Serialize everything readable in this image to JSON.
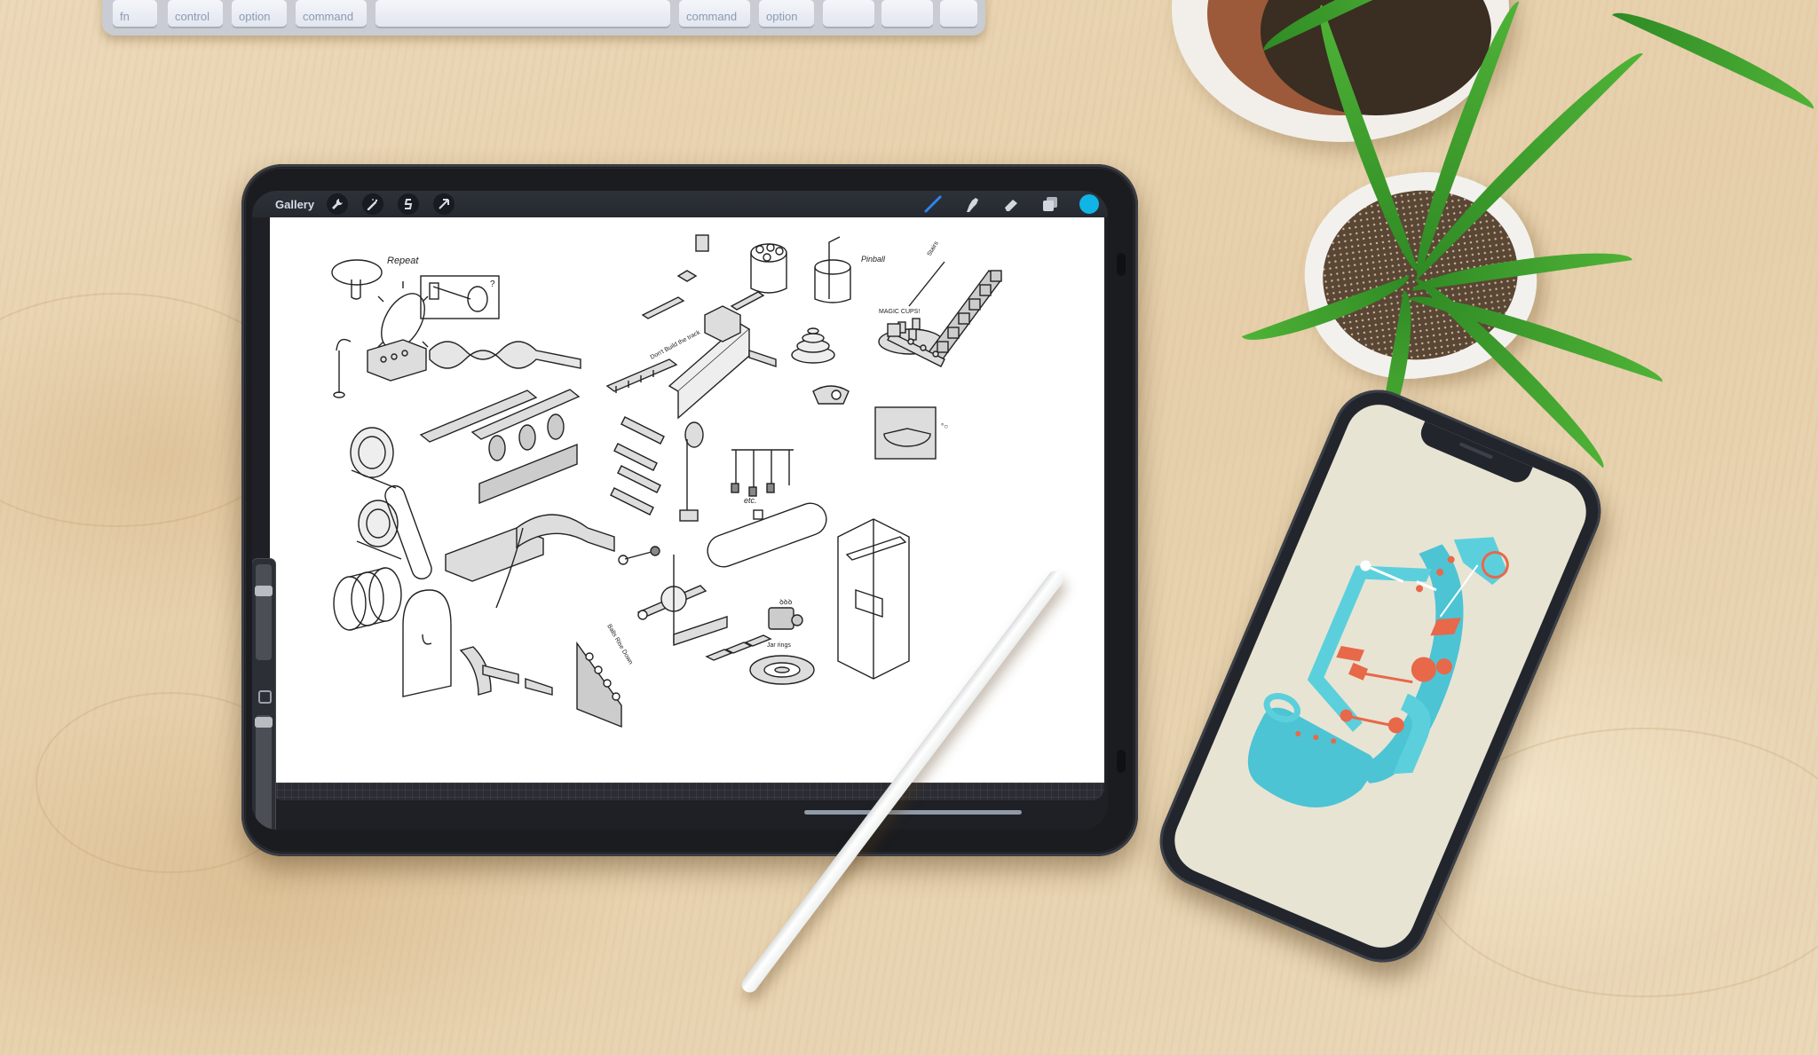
{
  "scene": {
    "desk_color": "#e9d5b4",
    "objects": [
      "keyboard",
      "tablet",
      "stylus-pencil",
      "smartphone",
      "potted-plants"
    ]
  },
  "keyboard": {
    "keys": [
      "fn",
      "control",
      "option",
      "command",
      "",
      "command",
      "option",
      "◀",
      "▼",
      "▶"
    ]
  },
  "app": {
    "toolbar": {
      "gallery_label": "Gallery",
      "left_tools": [
        {
          "name": "actions",
          "icon": "wrench-icon"
        },
        {
          "name": "adjustments",
          "icon": "magic-wand-icon"
        },
        {
          "name": "selection",
          "icon": "selection-s-icon"
        },
        {
          "name": "transform",
          "icon": "arrow-cursor-icon"
        }
      ],
      "right_tools": [
        {
          "name": "brush",
          "icon": "brush-icon",
          "active": true
        },
        {
          "name": "smudge",
          "icon": "smudge-finger-icon"
        },
        {
          "name": "eraser",
          "icon": "eraser-icon"
        },
        {
          "name": "layers",
          "icon": "layers-icon"
        },
        {
          "name": "color",
          "icon": "color-swatch",
          "value": "#10b4e6"
        }
      ]
    },
    "sidebar": {
      "brush_size": 0.12,
      "opacity": 0.02,
      "modify_button": "square",
      "undo_icon": "↶",
      "redo_icon": "↷"
    },
    "canvas": {
      "annotations": [
        "Repeat",
        "?",
        "Pinball",
        "MAGIC CUPS!",
        "Stairs",
        "Don't Build the track",
        "Balls Rise Down",
        "Jar rings",
        "etc."
      ],
      "sketch_items": [
        "mushroom",
        "gear-wheel",
        "pulley-box",
        "spiral-loop",
        "block-stack",
        "zigzag-track",
        "ladder-rail",
        "ring-bridge",
        "chain-link",
        "jar-with-balls",
        "cup-straw",
        "magic-cups",
        "stairs-conveyor",
        "spring-coil",
        "tunnel-arch",
        "curve-chute",
        "cross-lever",
        "dominoes",
        "slot-machine",
        "ring-track",
        "pie-box",
        "boat",
        "stepped-cone",
        "pin-rail",
        "pendulums",
        "oval-track",
        "drop-box"
      ]
    }
  },
  "phone": {
    "screen_bg": "#e8e4d4",
    "illustration_colors": {
      "primary": "#4cc4d4",
      "accent": "#e8684a"
    }
  }
}
